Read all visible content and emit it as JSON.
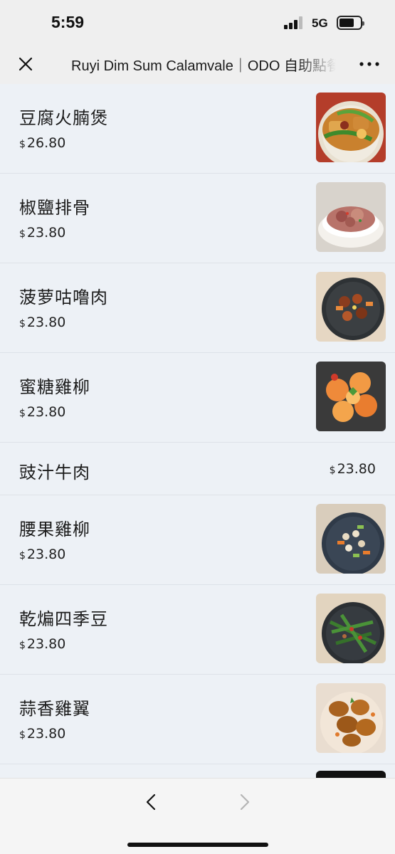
{
  "status_bar": {
    "time": "5:59",
    "network": "5G",
    "icons": [
      "signal-icon",
      "battery-icon"
    ]
  },
  "nav": {
    "title": "Ruyi Dim Sum Calamvale｜ODO 自助點餐",
    "icons": [
      "close-icon",
      "more-icon"
    ]
  },
  "currency_symbol": "$",
  "menu_items": [
    {
      "name": "豆腐火腩煲",
      "price": "26.80",
      "has_photo": true
    },
    {
      "name": "椒鹽排骨",
      "price": "23.80",
      "has_photo": true
    },
    {
      "name": "菠萝咕噜肉",
      "price": "23.80",
      "has_photo": true
    },
    {
      "name": "蜜糖雞柳",
      "price": "23.80",
      "has_photo": true
    },
    {
      "name": "豉汁牛肉",
      "price": "23.80",
      "has_photo": false
    },
    {
      "name": "腰果雞柳",
      "price": "23.80",
      "has_photo": true
    },
    {
      "name": "乾煸四季豆",
      "price": "23.80",
      "has_photo": true
    },
    {
      "name": "蒜香雞翼",
      "price": "23.80",
      "has_photo": true
    }
  ],
  "bottom_bar": {
    "icons": [
      "back-icon",
      "forward-icon"
    ]
  }
}
